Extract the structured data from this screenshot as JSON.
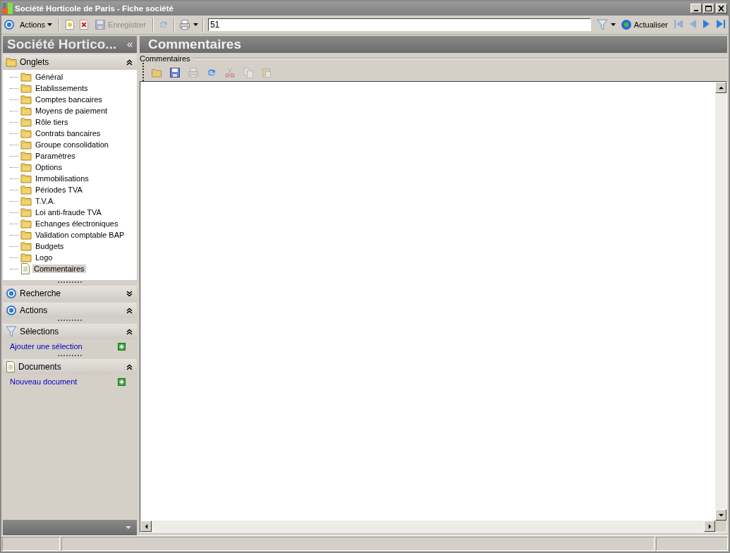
{
  "window": {
    "title": "Société Horticole de Paris -  Fiche société",
    "controls": [
      {
        "kind": "minimize"
      },
      {
        "kind": "maximize"
      },
      {
        "kind": "close"
      }
    ]
  },
  "toolbar": {
    "actions_menu": "Actions",
    "buttons": [
      {
        "kind": "new",
        "disabled": false
      },
      {
        "kind": "delete",
        "disabled": false
      },
      {
        "kind": "save",
        "label": "Enregistrer",
        "disabled": true
      },
      {
        "kind": "refresh",
        "disabled": true
      },
      {
        "kind": "print",
        "disabled": false
      }
    ],
    "search": {
      "value": "51"
    },
    "refresh_label": "Actualiser",
    "nav": [
      {
        "kind": "first",
        "disabled": true
      },
      {
        "kind": "prev",
        "disabled": true
      },
      {
        "kind": "next",
        "disabled": false
      },
      {
        "kind": "last",
        "disabled": false
      }
    ]
  },
  "sidebar": {
    "title": "Société Hortico...",
    "tree": {
      "label": "Onglets",
      "expanded": true,
      "items": [
        {
          "label": "Général",
          "kind": "folder",
          "selected": false
        },
        {
          "label": "Etablissements",
          "kind": "folder",
          "selected": false
        },
        {
          "label": "Comptes bancaires",
          "kind": "folder",
          "selected": false
        },
        {
          "label": "Moyens de paiement",
          "kind": "folder",
          "selected": false
        },
        {
          "label": "Rôle tiers",
          "kind": "folder",
          "selected": false
        },
        {
          "label": "Contrats bancaires",
          "kind": "folder",
          "selected": false
        },
        {
          "label": "Groupe consolidation",
          "kind": "folder",
          "selected": false
        },
        {
          "label": "Paramètres",
          "kind": "folder",
          "selected": false
        },
        {
          "label": "Options",
          "kind": "folder",
          "selected": false
        },
        {
          "label": "Immobilisations",
          "kind": "folder",
          "selected": false
        },
        {
          "label": "Périodes TVA",
          "kind": "folder",
          "selected": false
        },
        {
          "label": "T.V.A.",
          "kind": "folder",
          "selected": false
        },
        {
          "label": "Loi anti-fraude TVA",
          "kind": "folder",
          "selected": false
        },
        {
          "label": "Echanges électroniques",
          "kind": "folder",
          "selected": false
        },
        {
          "label": "Validation comptable BAP",
          "kind": "folder",
          "selected": false
        },
        {
          "label": "Budgets",
          "kind": "folder",
          "selected": false
        },
        {
          "label": "Logo",
          "kind": "folder",
          "selected": false
        },
        {
          "label": "Commentaires",
          "kind": "document",
          "selected": true
        }
      ]
    },
    "sections": [
      {
        "label": "Recherche",
        "kind": "circle",
        "expanded": false
      },
      {
        "label": "Actions",
        "kind": "circle",
        "expanded": true
      },
      {
        "label": "Sélections",
        "kind": "filter",
        "expanded": true,
        "link": "Ajouter une sélection"
      },
      {
        "label": "Documents",
        "kind": "document",
        "expanded": true,
        "link": "Nouveau document"
      }
    ]
  },
  "main": {
    "title": "Commentaires",
    "group_label": "Commentaires",
    "tools": [
      {
        "kind": "open",
        "disabled": false
      },
      {
        "kind": "save",
        "disabled": false
      },
      {
        "kind": "print",
        "disabled": true
      },
      {
        "kind": "refresh",
        "disabled": false
      },
      {
        "kind": "cut",
        "disabled": true
      },
      {
        "kind": "copy",
        "disabled": true
      },
      {
        "kind": "paste",
        "disabled": true
      }
    ]
  }
}
